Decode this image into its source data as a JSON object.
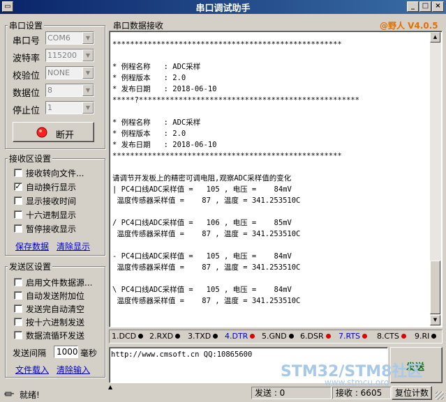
{
  "window": {
    "title": "串口调试助手"
  },
  "serial_settings": {
    "group_label": "串口设置",
    "port_label": "串口号",
    "port_value": "COM6",
    "baud_label": "波特率",
    "baud_value": "115200",
    "parity_label": "校验位",
    "parity_value": "NONE",
    "data_label": "数据位",
    "data_value": "8",
    "stop_label": "停止位",
    "stop_value": "1",
    "toggle_label": "断开"
  },
  "receive_settings": {
    "group_label": "接收区设置",
    "options": [
      {
        "label": "接收转向文件...",
        "checked": false
      },
      {
        "label": "自动换行显示",
        "checked": true
      },
      {
        "label": "显示接收时间",
        "checked": false
      },
      {
        "label": "十六进制显示",
        "checked": false
      },
      {
        "label": "暂停接收显示",
        "checked": false
      }
    ],
    "save_link": "保存数据",
    "clear_link": "清除显示"
  },
  "send_settings": {
    "group_label": "发送区设置",
    "options": [
      {
        "label": "启用文件数据源...",
        "checked": false
      },
      {
        "label": "自动发送附加位",
        "checked": false
      },
      {
        "label": "发送完自动清空",
        "checked": false
      },
      {
        "label": "按十六进制发送",
        "checked": false
      },
      {
        "label": "数据流循环发送",
        "checked": false
      }
    ],
    "interval_label": "发送间隔",
    "interval_value": "1000",
    "interval_unit": "毫秒",
    "load_link": "文件载入",
    "clear_link": "清除输入"
  },
  "receive_area": {
    "label": "串口数据接收",
    "brand": "@野人 V4.0.5",
    "lines": [
      "****************************************************",
      "",
      "* 例程名称   : ADC采样",
      "* 例程版本   : 2.0",
      "* 发布日期   : 2018-06-10",
      "*****?**************************************************",
      "",
      "* 例程名称   : ADC采样",
      "* 例程版本   : 2.0",
      "* 发布日期   : 2018-06-10",
      "****************************************************",
      "",
      "请调节开发板上的精密可调电阻,观察ADC采样值的变化",
      "| PC4口线ADC采样值 =   105 , 电压 =    84mV",
      " 温度传感器采样值 =    87 , 温度 = 341.253510C",
      "",
      "/ PC4口线ADC采样值 =   106 , 电压 =    85mV",
      " 温度传感器采样值 =    87 , 温度 = 341.253510C",
      "",
      "- PC4口线ADC采样值 =   105 , 电压 =    84mV",
      " 温度传感器采样值 =    87 , 温度 = 341.253510C",
      "",
      "\\ PC4口线ADC采样值 =   105 , 电压 =    84mV",
      " 温度传感器采样值 =    87 , 温度 = 341.253510C"
    ]
  },
  "signals": [
    {
      "label": "1.DCD",
      "color": "#000000",
      "dot": "#000000"
    },
    {
      "label": "2.RXD",
      "color": "#000000",
      "dot": "#000000"
    },
    {
      "label": "3.TXD",
      "color": "#000000",
      "dot": "#000000"
    },
    {
      "label": "4.DTR",
      "color": "#0000cc",
      "dot": "#dd0000"
    },
    {
      "label": "5.GND",
      "color": "#000000",
      "dot": "#000000"
    },
    {
      "label": "6.DSR",
      "color": "#000000",
      "dot": "#dd0000"
    },
    {
      "label": "7.RTS",
      "color": "#0000cc",
      "dot": "#dd0000"
    },
    {
      "label": "8.CTS",
      "color": "#000000",
      "dot": "#dd0000"
    },
    {
      "label": "9.RI",
      "color": "#000000",
      "dot": "#000000"
    }
  ],
  "send_area": {
    "text": "http://www.cmsoft.cn QQ:10865600",
    "send_button": "发送"
  },
  "status": {
    "ready": "就绪!",
    "sent": "发送 : 0",
    "received": "接收 : 6605",
    "reset": "复位计数"
  },
  "watermark": {
    "line1": "STM32/STM8社区",
    "line2": "www.stmcu.org"
  }
}
